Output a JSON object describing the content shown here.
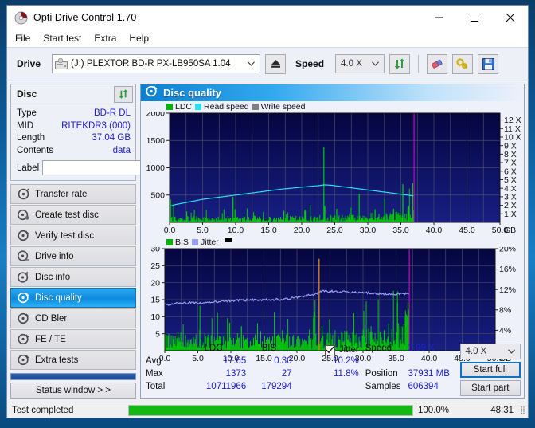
{
  "window": {
    "title": "Opti Drive Control 1.70",
    "icon": "disc-icon",
    "minimize": "minimize-icon",
    "maximize": "maximize-icon",
    "close": "close-icon"
  },
  "menu": {
    "items": [
      "File",
      "Start test",
      "Extra",
      "Help"
    ]
  },
  "toolbar": {
    "drive_label": "Drive",
    "drive_value": "(J:)  PLEXTOR BD-R  PX-LB950SA 1.04",
    "eject": "eject-icon",
    "speed_label": "Speed",
    "speed_value": "4.0 X",
    "refresh": "refresh-icon",
    "eraser": "eraser-icon",
    "key": "key-icon",
    "save": "save-icon"
  },
  "disc": {
    "header": "Disc",
    "refresh": "refresh-icon",
    "rows": [
      {
        "key": "Type",
        "value": "BD-R DL"
      },
      {
        "key": "MID",
        "value": "RITEKDR3 (000)"
      },
      {
        "key": "Length",
        "value": "37.04 GB"
      },
      {
        "key": "Contents",
        "value": "data"
      }
    ],
    "label_key": "Label",
    "label_value": "",
    "label_placeholder": "",
    "cd_button": "disc-icon"
  },
  "sidebar": {
    "items": [
      {
        "label": "Transfer rate",
        "selected": false
      },
      {
        "label": "Create test disc",
        "selected": false
      },
      {
        "label": "Verify test disc",
        "selected": false
      },
      {
        "label": "Drive info",
        "selected": false
      },
      {
        "label": "Disc info",
        "selected": false
      },
      {
        "label": "Disc quality",
        "selected": true
      },
      {
        "label": "CD Bler",
        "selected": false
      },
      {
        "label": "FE / TE",
        "selected": false
      },
      {
        "label": "Extra tests",
        "selected": false
      }
    ],
    "status_window_button": "Status window > >"
  },
  "panel": {
    "title": "Disc quality",
    "icon": "disc-quality-icon"
  },
  "stats": {
    "col_headers": [
      "LDC",
      "BIS"
    ],
    "row_labels": [
      "Avg",
      "Max",
      "Total"
    ],
    "ldc": {
      "avg": "17.65",
      "max": "1373",
      "total": "10711966"
    },
    "bis": {
      "avg": "0.30",
      "max": "27",
      "total": "179294"
    },
    "jitter_label": "Jitter",
    "jitter_checked": true,
    "jitter_avg": "10.2%",
    "jitter_max": "11.8%",
    "speed_label": "Speed",
    "speed_value": "2.99 X",
    "position_label": "Position",
    "position_value": "37931 MB",
    "samples_label": "Samples",
    "samples_value": "606394",
    "speed_select": "4.0 X",
    "start_full": "Start full",
    "start_part": "Start part"
  },
  "statusbar": {
    "text": "Test completed",
    "progress_pct": "100.0%",
    "progress_value": 100,
    "time": "48:31"
  },
  "colors": {
    "ldc": "#00c000",
    "bis": "#22cc22",
    "read_speed": "#29e2f0",
    "write_speed": "#808080",
    "jitter": "#9aa0f0",
    "plot_bg_top": "#05053f",
    "plot_bg_bottom": "#151c7a",
    "end_marker": "#c000c0",
    "accent": "#0d8ae0",
    "value_text": "#2020cc",
    "progress": "#14b814"
  },
  "chart_data": [
    {
      "type": "line",
      "name": "disc-quality-ldc-chart",
      "title": "",
      "xlabel": "GB",
      "ylabel": "",
      "xlim": [
        0,
        50
      ],
      "xticks": [
        0.0,
        5.0,
        10.0,
        15.0,
        20.0,
        25.0,
        30.0,
        35.0,
        40.0,
        45.0,
        50.0
      ],
      "xticklabels": [
        "0.0",
        "5.0",
        "10.0",
        "15.0",
        "20.0",
        "25.0",
        "30.0",
        "35.0",
        "40.0",
        "45.0",
        "50.0"
      ],
      "ylim": [
        0,
        2000
      ],
      "yticks": [
        500,
        1000,
        1500,
        2000
      ],
      "yticklabels": [
        "500",
        "1000",
        "1500",
        "2000"
      ],
      "y2lim": [
        0,
        12.8
      ],
      "y2ticks": [
        1,
        2,
        3,
        4,
        5,
        6,
        7,
        8,
        9,
        10,
        11,
        12
      ],
      "y2ticklabels": [
        "1 X",
        "2 X",
        "3 X",
        "4 X",
        "5 X",
        "6 X",
        "7 X",
        "8 X",
        "9 X",
        "10 X",
        "11 X",
        "12 X"
      ],
      "grid": true,
      "legend": [
        {
          "label": "LDC",
          "color": "#00c000"
        },
        {
          "label": "Read speed",
          "color": "#29e2f0"
        },
        {
          "label": "Write speed",
          "color": "#808080"
        }
      ],
      "end_marker_x": 37.0,
      "data_end_x": 36.9,
      "series": [
        {
          "name": "Read speed",
          "color": "#29e2f0",
          "axis": "right",
          "x": [
            0.1,
            1,
            3,
            5,
            7,
            9,
            11,
            13,
            15,
            17,
            19,
            21,
            22.5,
            23.4,
            24.5,
            26,
            28,
            30,
            32,
            34,
            35.5,
            36.5,
            36.9
          ],
          "y": [
            1.9,
            2.1,
            2.4,
            2.7,
            2.9,
            3.1,
            3.3,
            3.5,
            3.7,
            3.9,
            4.05,
            4.2,
            4.3,
            4.4,
            4.35,
            4.2,
            4.0,
            3.8,
            3.6,
            3.4,
            3.25,
            3.15,
            3.1
          ]
        },
        {
          "name": "LDC",
          "color": "#00c000",
          "axis": "left",
          "note": "dense per-sample error counts, baseline ~20-120 with intermittent spikes",
          "baseline_range": [
            10,
            120
          ],
          "spikes": [
            {
              "x": 0.15,
              "y": 420
            },
            {
              "x": 2.6,
              "y": 200
            },
            {
              "x": 9.6,
              "y": 470
            },
            {
              "x": 9.9,
              "y": 240
            },
            {
              "x": 14.2,
              "y": 190
            },
            {
              "x": 17.3,
              "y": 210
            },
            {
              "x": 20.5,
              "y": 235
            },
            {
              "x": 23.35,
              "y": 1373
            },
            {
              "x": 23.5,
              "y": 300
            },
            {
              "x": 25.3,
              "y": 250
            },
            {
              "x": 28.7,
              "y": 520
            },
            {
              "x": 31.1,
              "y": 240
            },
            {
              "x": 33.9,
              "y": 250
            },
            {
              "x": 35.3,
              "y": 700
            },
            {
              "x": 36.2,
              "y": 300
            },
            {
              "x": 36.8,
              "y": 720
            }
          ]
        }
      ]
    },
    {
      "type": "line",
      "name": "disc-quality-bis-jitter-chart",
      "title": "",
      "xlabel": "GB",
      "ylabel": "",
      "xlim": [
        0,
        50
      ],
      "xticks": [
        0.0,
        5.0,
        10.0,
        15.0,
        20.0,
        25.0,
        30.0,
        35.0,
        40.0,
        45.0,
        50.0
      ],
      "xticklabels": [
        "0.0",
        "5.0",
        "10.0",
        "15.0",
        "20.0",
        "25.0",
        "30.0",
        "35.0",
        "40.0",
        "45.0",
        "50.0"
      ],
      "ylim": [
        0,
        30
      ],
      "yticks": [
        5,
        10,
        15,
        20,
        25,
        30
      ],
      "yticklabels": [
        "5",
        "10",
        "15",
        "20",
        "25",
        "30"
      ],
      "y2lim": [
        0,
        20
      ],
      "y2ticks": [
        4,
        8,
        12,
        16,
        20
      ],
      "y2ticklabels": [
        "4%",
        "8%",
        "12%",
        "16%",
        "20%"
      ],
      "grid": true,
      "legend": [
        {
          "label": "BIS",
          "color": "#22cc22"
        },
        {
          "label": "Jitter",
          "color": "#9aa0f0"
        }
      ],
      "end_marker_x": 37.0,
      "data_end_x": 36.9,
      "series": [
        {
          "name": "Jitter",
          "color": "#9aa0f0",
          "axis": "right",
          "x": [
            0.1,
            1,
            2,
            4,
            6,
            8,
            10,
            12,
            14,
            16,
            18,
            20,
            22,
            23.3,
            24,
            26,
            28,
            30,
            32,
            34,
            36,
            36.9
          ],
          "y": [
            9.2,
            9.0,
            9.3,
            9.4,
            9.4,
            9.6,
            9.8,
            9.9,
            10.0,
            10.0,
            10.1,
            10.5,
            10.9,
            11.4,
            11.7,
            11.6,
            11.5,
            11.4,
            11.2,
            11.1,
            11.2,
            11.2
          ]
        },
        {
          "name": "BIS",
          "color": "#22cc22",
          "axis": "left",
          "note": "dense per-sample error counts, baseline ~1-5 with spikes",
          "baseline_range": [
            0.5,
            5
          ],
          "spikes": [
            {
              "x": 2.0,
              "y": 5.5
            },
            {
              "x": 5.3,
              "y": 6.1
            },
            {
              "x": 9.5,
              "y": 9.6
            },
            {
              "x": 9.8,
              "y": 8.2
            },
            {
              "x": 11.6,
              "y": 7.2
            },
            {
              "x": 17.8,
              "y": 6.0
            },
            {
              "x": 21.9,
              "y": 6.2
            },
            {
              "x": 23.35,
              "y": 27
            },
            {
              "x": 23.8,
              "y": 7.2
            },
            {
              "x": 28.6,
              "y": 11.0
            },
            {
              "x": 30.5,
              "y": 6.2
            },
            {
              "x": 33.2,
              "y": 6.0
            },
            {
              "x": 35.2,
              "y": 14.1
            },
            {
              "x": 36.4,
              "y": 9.8
            },
            {
              "x": 36.8,
              "y": 14.1
            }
          ]
        }
      ]
    }
  ]
}
